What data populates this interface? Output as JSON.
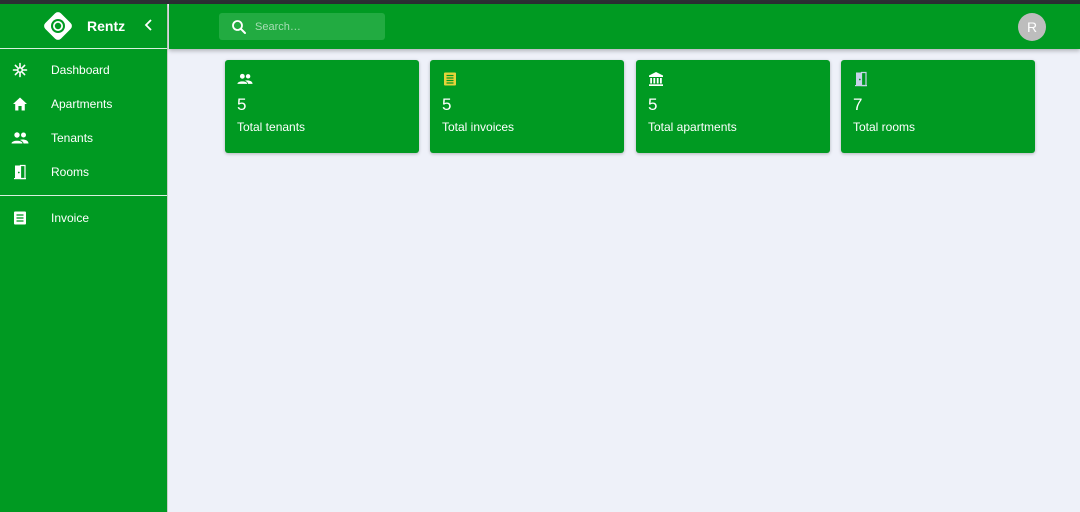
{
  "app": {
    "name": "Rentz"
  },
  "sidebar": {
    "items": [
      {
        "label": "Dashboard",
        "icon": "dashboard-icon"
      },
      {
        "label": "Apartments",
        "icon": "home-icon"
      },
      {
        "label": "Tenants",
        "icon": "people-icon"
      },
      {
        "label": "Rooms",
        "icon": "door-icon"
      }
    ],
    "secondary": [
      {
        "label": "Invoice",
        "icon": "receipt-icon"
      }
    ]
  },
  "header": {
    "search": {
      "placeholder": "Search…"
    },
    "avatar": {
      "initial": "R"
    }
  },
  "stats": [
    {
      "value": "5",
      "label": "Total tenants",
      "icon": "people-icon",
      "icon_color": "#ffffff"
    },
    {
      "value": "5",
      "label": "Total invoices",
      "icon": "receipt-icon",
      "icon_color": "#e6d33a"
    },
    {
      "value": "5",
      "label": "Total apartments",
      "icon": "bank-icon",
      "icon_color": "#ffffff"
    },
    {
      "value": "7",
      "label": "Total rooms",
      "icon": "door-icon",
      "icon_color": "#c7d3ea"
    }
  ],
  "colors": {
    "primary": "#009a22",
    "background": "#eef1f9",
    "search_bg": "#22ab41",
    "avatar_bg": "#bdbdbd"
  }
}
